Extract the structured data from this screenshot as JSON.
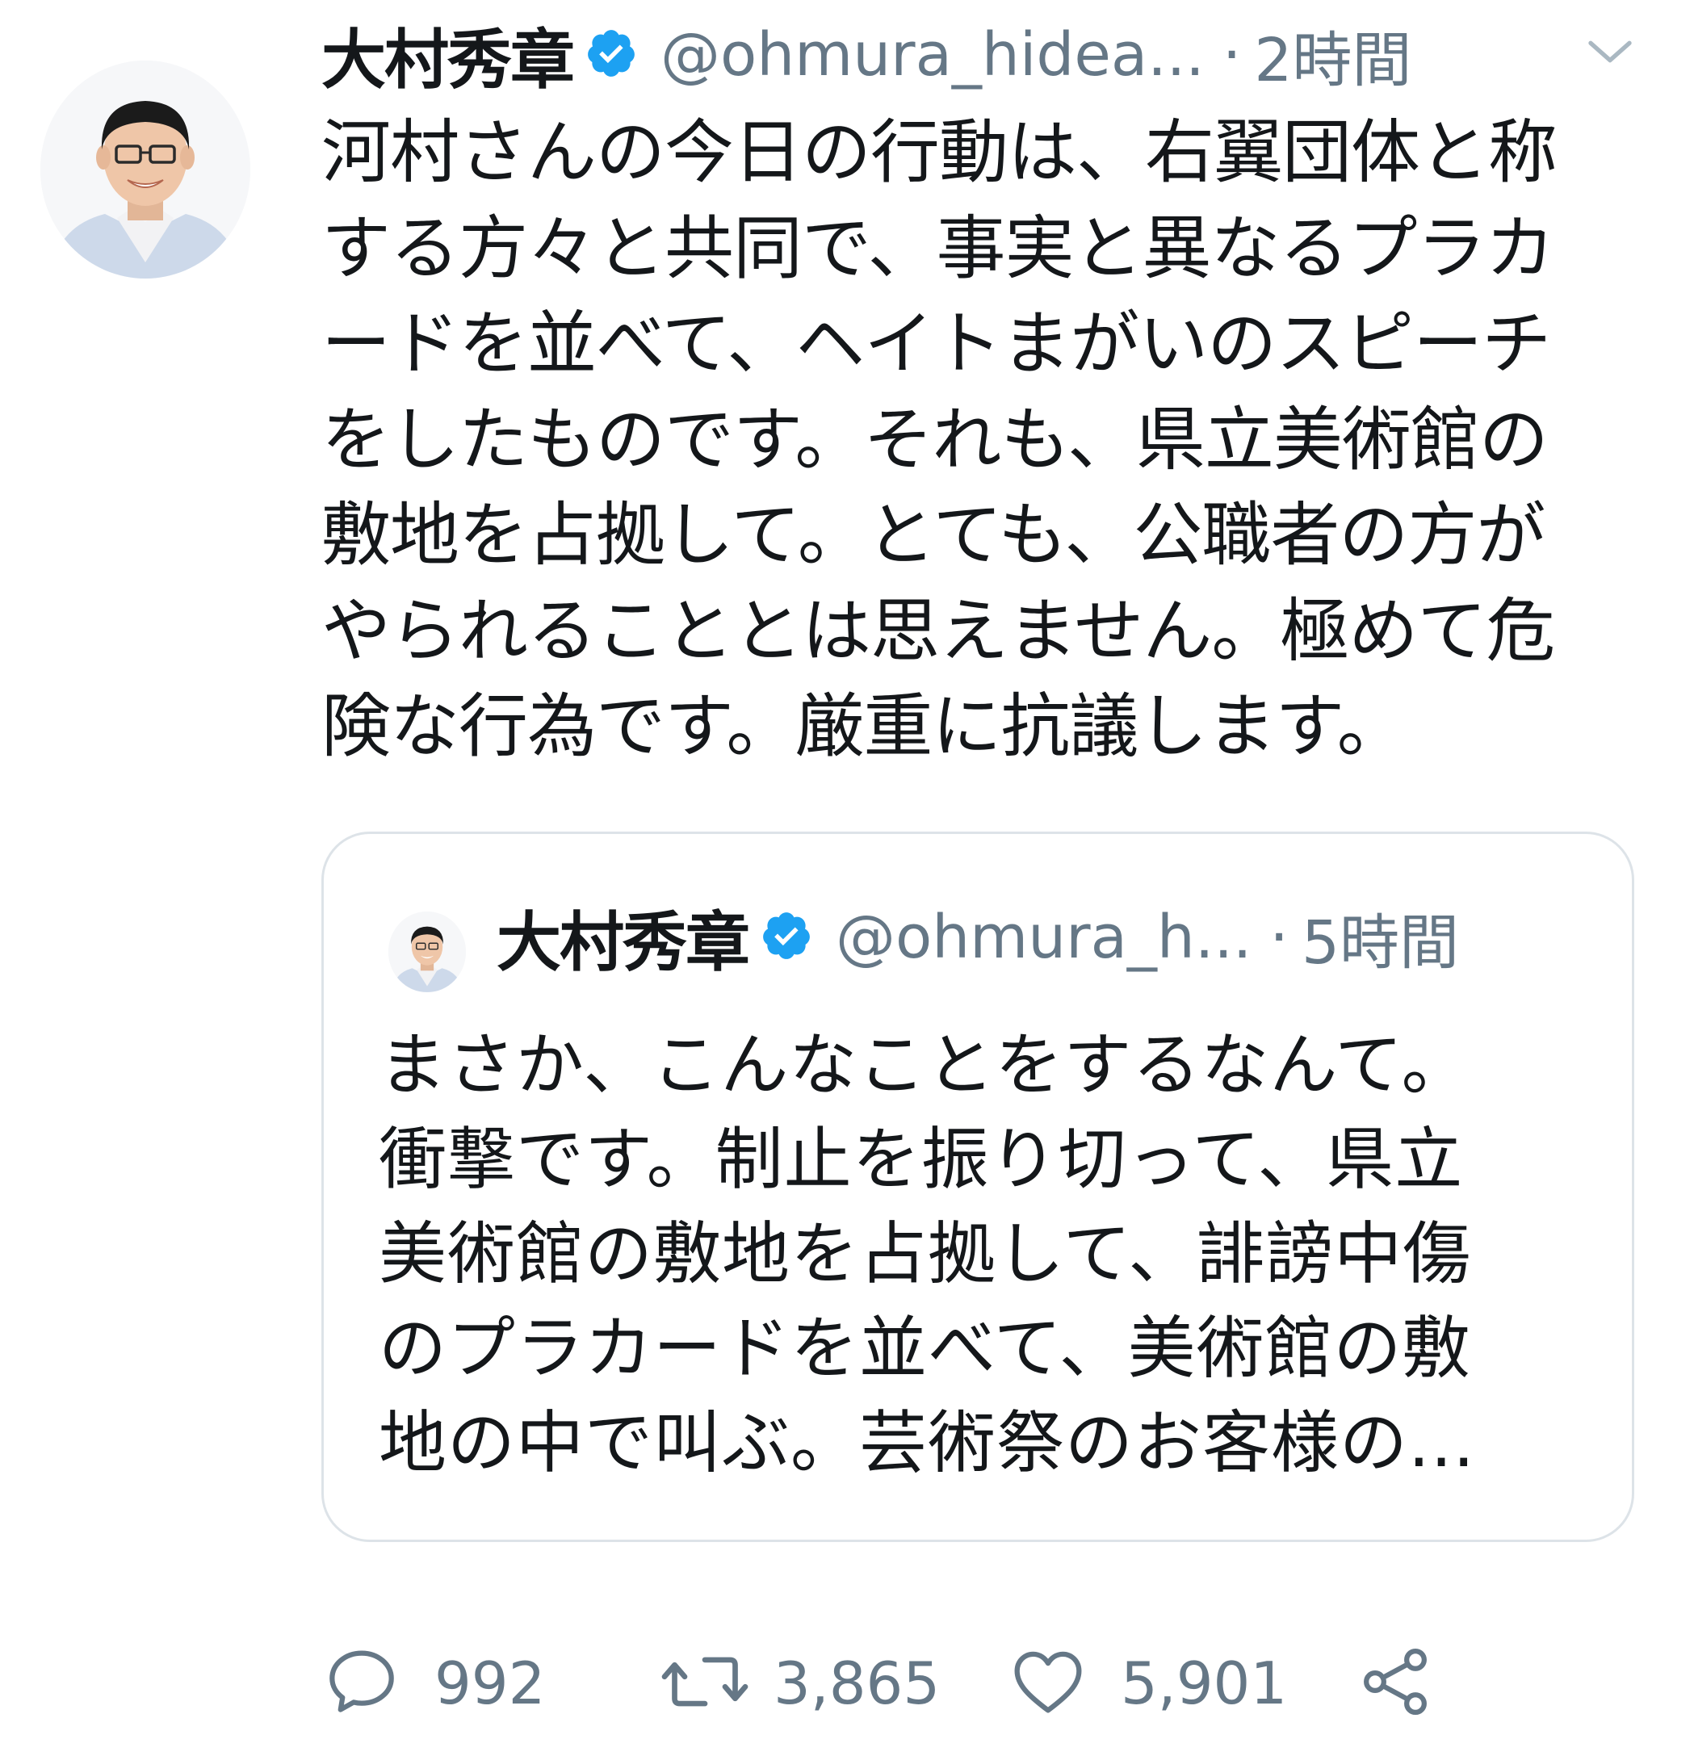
{
  "tweet": {
    "author_name": "大村秀章",
    "handle": "@ohmura_hidea...",
    "separator": "·",
    "time": "2時間",
    "text": "河村さんの今日の行動は、右翼団体と称\nする方々と共同で、事実と異なるプラカ\nードを並べて、ヘイトまがいのスピーチ\nをしたものです。それも、県立美術館の\n敷地を占拠して。とても、公職者の方が\nやられることとは思えません。極めて危\n険な行為です。厳重に抗議します。"
  },
  "quoted_tweet": {
    "author_name": "大村秀章",
    "handle": "@ohmura_h...",
    "separator": "·",
    "time": "5時間",
    "text": "まさか、こんなことをするなんて。\n衝撃です。制止を振り切って、県立\n美術館の敷地を占拠して、誹謗中傷\nのプラカードを並べて、美術館の敷\n地の中で叫ぶ。芸術祭のお客様の..."
  },
  "actions": {
    "reply_count": "992",
    "retweet_count": "3,865",
    "like_count": "5,901"
  },
  "colors": {
    "verified_blue": "#1da1f2",
    "secondary_text": "#657786",
    "border": "#dde3e8"
  },
  "icons": [
    "verified-badge-icon",
    "chevron-down-icon",
    "reply-icon",
    "retweet-icon",
    "like-icon",
    "share-icon"
  ]
}
